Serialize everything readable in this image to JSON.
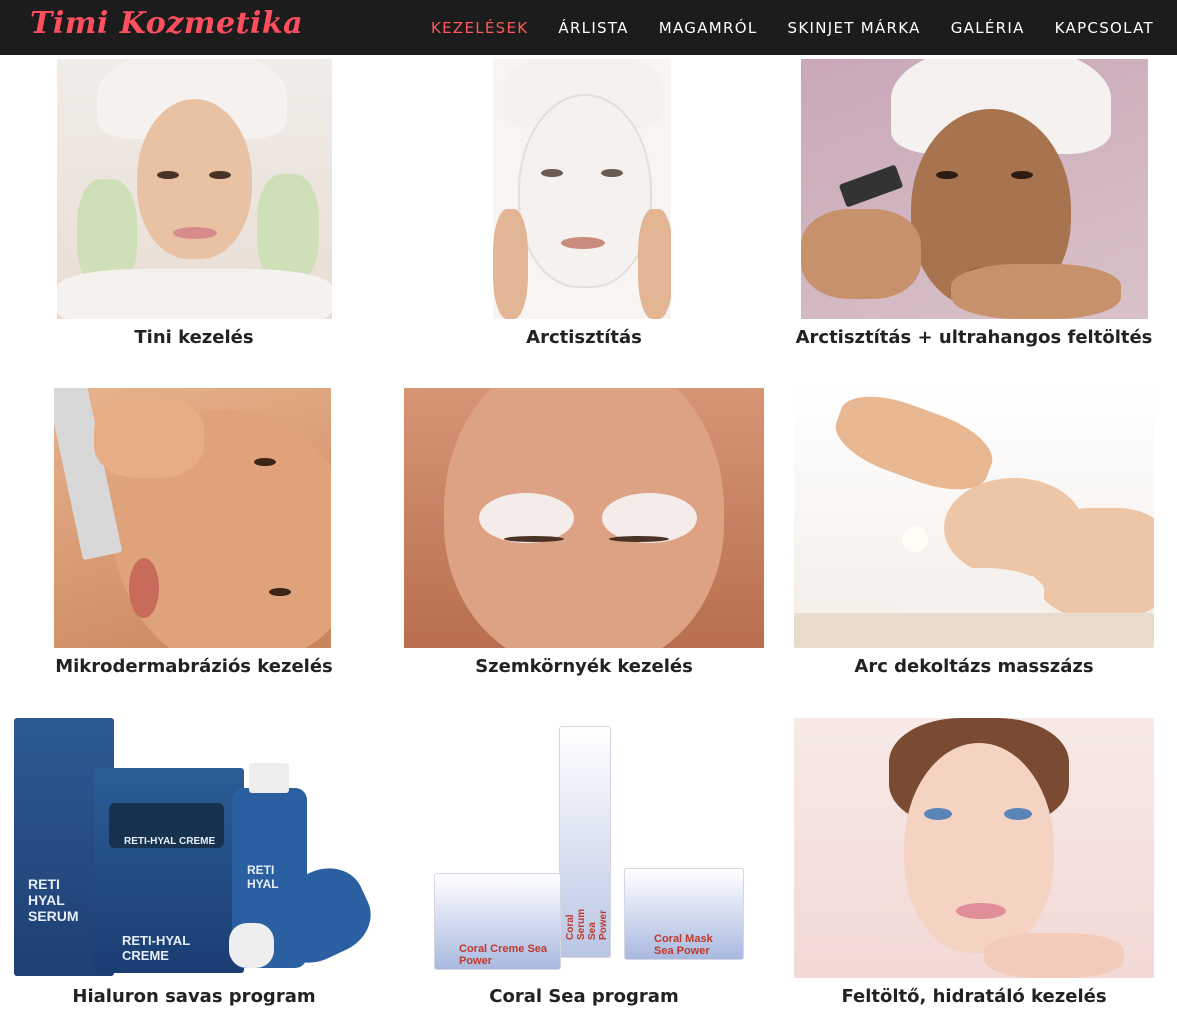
{
  "brand": {
    "logo_text": "Timi Kozmetika"
  },
  "nav": {
    "items": [
      {
        "label": "KEZELÉSEK",
        "active": true
      },
      {
        "label": "ÁRLISTA",
        "active": false
      },
      {
        "label": "MAGAMRÓL",
        "active": false
      },
      {
        "label": "SKINJET MÁRKA",
        "active": false
      },
      {
        "label": "GALÉRIA",
        "active": false
      },
      {
        "label": "KAPCSOLAT",
        "active": false
      }
    ]
  },
  "treatments": [
    {
      "title": "Tini kezelés"
    },
    {
      "title": "Arctisztítás"
    },
    {
      "title": "Arctisztítás + ultrahangos feltöltés"
    },
    {
      "title": "Mikrodermabráziós kezelés"
    },
    {
      "title": "Szemkörnyék kezelés"
    },
    {
      "title": "Arc dekoltázs masszázs"
    },
    {
      "title": "Hialuron savas program"
    },
    {
      "title": "Coral Sea program"
    },
    {
      "title": "Feltöltő, hidratáló kezelés"
    }
  ],
  "products": {
    "reti_hyal": [
      "RETI-HYAL CREME",
      "RETI HYAL",
      "RETI HYAL SERUM",
      "RETI-HYAL CREME"
    ],
    "coral": [
      "Coral Serum Sea Power",
      "Coral Creme Sea Power",
      "Coral Mask Sea Power"
    ]
  },
  "colors": {
    "accent": "#ff5a5a",
    "nav_bg": "#1c1c1c",
    "title": "#222222"
  }
}
